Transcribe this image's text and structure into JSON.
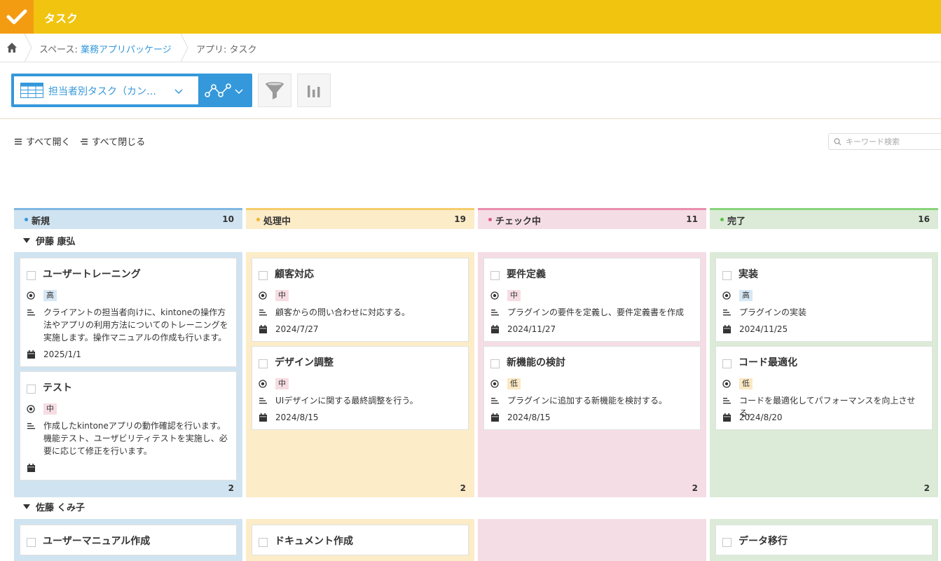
{
  "app": {
    "title": "タスク"
  },
  "breadcrumb": {
    "space_prefix": "スペース: ",
    "space_name": "業務アプリパッケージ",
    "app_prefix": "アプリ: ",
    "app_name": "タスク"
  },
  "toolbar": {
    "view_label": "担当者別タスク（カン…",
    "accent": "#3498db"
  },
  "controls": {
    "expand_all": "すべて開く",
    "collapse_all": "すべて閉じる",
    "search_placeholder": "キーワード検索"
  },
  "columns": [
    {
      "name": "新規",
      "count": "10",
      "color": "#d0e3f0",
      "border": "#7fb7e3",
      "dot": "#3498db"
    },
    {
      "name": "処理中",
      "count": "19",
      "color": "#fcecc8",
      "border": "#f5cd6a",
      "dot": "#f1b32b"
    },
    {
      "name": "チェック中",
      "count": "11",
      "color": "#f5dde5",
      "border": "#e98fae",
      "dot": "#e0578a"
    },
    {
      "name": "完了",
      "count": "16",
      "color": "#dcebd8",
      "border": "#89d47c",
      "dot": "#5cc14c"
    }
  ],
  "lanes": [
    {
      "name": "伊藤 康弘",
      "counts": [
        "2",
        "2",
        "2",
        "2"
      ],
      "cards": [
        [
          {
            "title": "ユーザートレーニング",
            "priority": "高",
            "level": "high",
            "desc": "クライアントの担当者向けに、kintoneの操作方法やアプリの利用方法についてのトレーニングを実施します。操作マニュアルの作成も行います。",
            "date": "2025/1/1"
          },
          {
            "title": "テスト",
            "priority": "中",
            "level": "mid",
            "desc": "作成したkintoneアプリの動作確認を行います。機能テスト、ユーザビリティテストを実施し、必要に応じて修正を行います。",
            "date": ""
          }
        ],
        [
          {
            "title": "顧客対応",
            "priority": "中",
            "level": "mid",
            "desc": "顧客からの問い合わせに対応する。",
            "date": "2024/7/27"
          },
          {
            "title": "デザイン調整",
            "priority": "中",
            "level": "mid",
            "desc": "UIデザインに関する最終調整を行う。",
            "date": "2024/8/15"
          }
        ],
        [
          {
            "title": "要件定義",
            "priority": "中",
            "level": "mid",
            "desc": "プラグインの要件を定義し、要件定義書を作成",
            "date": "2024/11/27"
          },
          {
            "title": "新機能の検討",
            "priority": "低",
            "level": "low",
            "desc": "プラグインに追加する新機能を検討する。",
            "date": "2024/8/15"
          }
        ],
        [
          {
            "title": "実装",
            "priority": "高",
            "level": "high",
            "desc": "プラグインの実装",
            "date": "2024/11/25"
          },
          {
            "title": "コード最適化",
            "priority": "低",
            "level": "low",
            "desc": "コードを最適化してパフォーマンスを向上させる。",
            "date": "2024/8/20"
          }
        ]
      ]
    },
    {
      "name": "佐藤 くみ子",
      "cards": [
        [
          {
            "title": "ユーザーマニュアル作成"
          }
        ],
        [
          {
            "title": "ドキュメント作成"
          }
        ],
        [],
        [
          {
            "title": "データ移行"
          }
        ]
      ]
    }
  ]
}
